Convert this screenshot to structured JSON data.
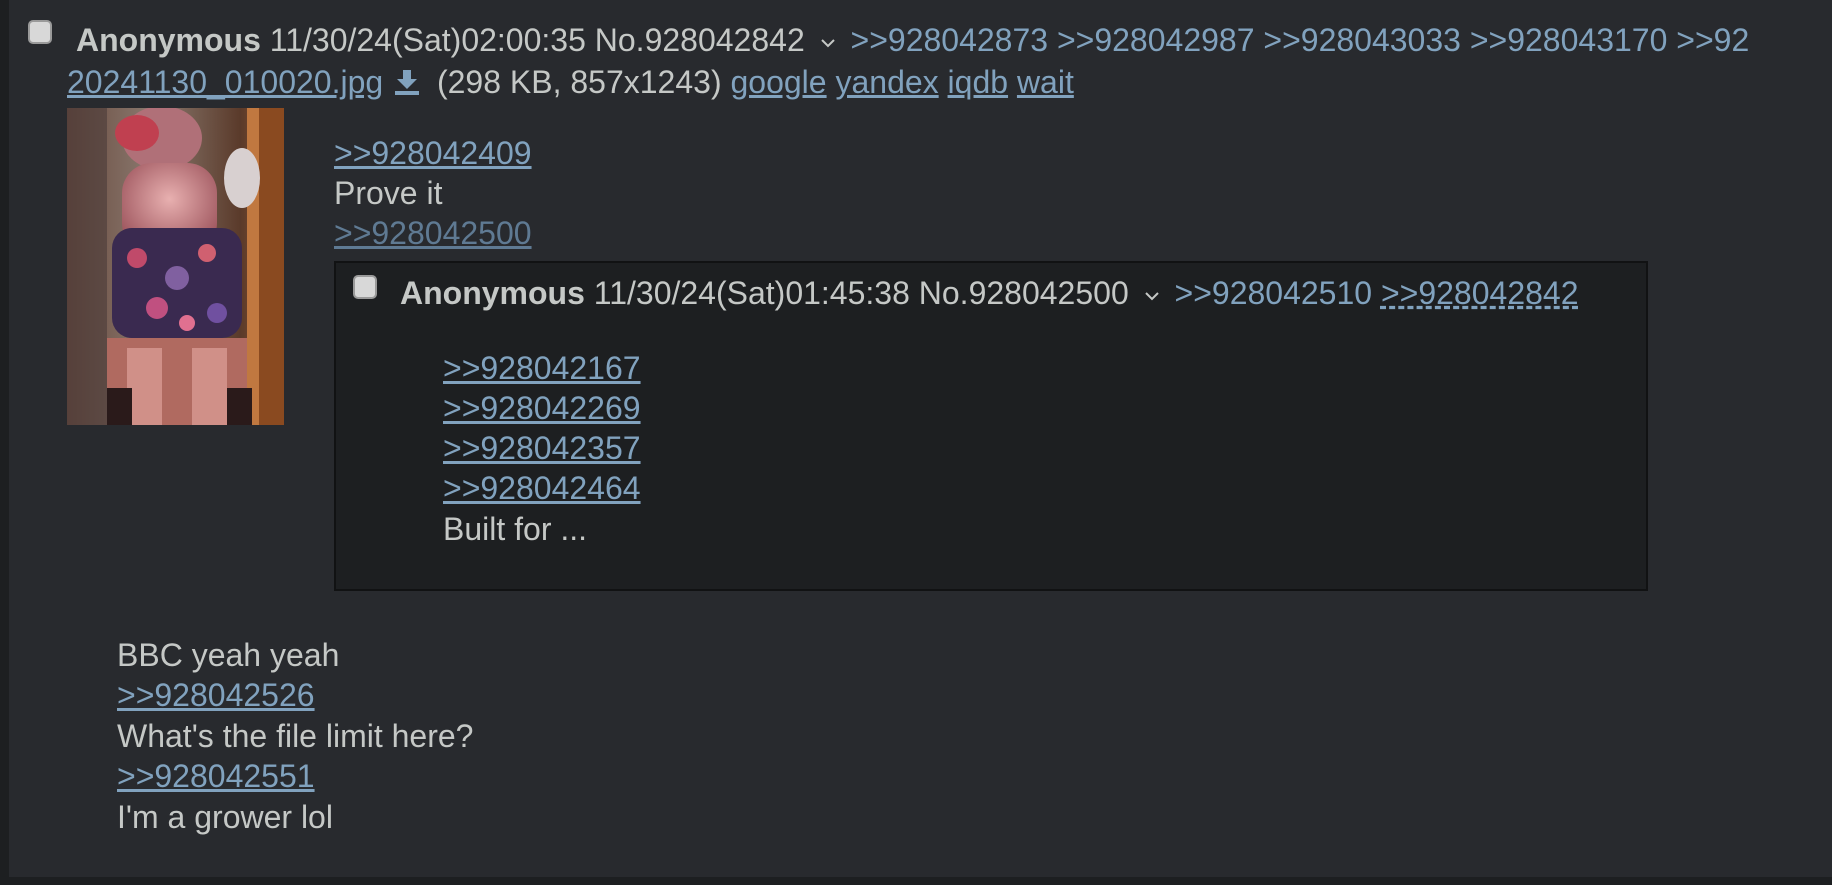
{
  "op_post": {
    "name": "Anonymous",
    "datetime": "11/30/24(Sat)02:00:35",
    "number": "No.928042842",
    "backlinks": [
      ">>928042873",
      ">>928042987",
      ">>928043033",
      ">>928043170",
      ">>92"
    ],
    "file": {
      "name": "20241130_010020.jpg",
      "info": "(298 KB, 857x1243)",
      "search_links": [
        "google",
        "yandex",
        "iqdb",
        "wait"
      ]
    },
    "quote_lines": [
      {
        "type": "link",
        "text": ">>928042409"
      },
      {
        "type": "text",
        "text": "Prove it"
      },
      {
        "type": "link-dim",
        "text": ">>928042500"
      }
    ],
    "body_lines": [
      {
        "type": "text",
        "text": "BBC yeah yeah"
      },
      {
        "type": "link",
        "text": ">>928042526"
      },
      {
        "type": "text",
        "text": "What's the file limit here?"
      },
      {
        "type": "link",
        "text": ">>928042551"
      },
      {
        "type": "text",
        "text": "I'm a grower lol"
      }
    ]
  },
  "inline_post": {
    "name": "Anonymous",
    "datetime": "11/30/24(Sat)01:45:38",
    "number": "No.928042500",
    "backlinks": [
      ">>928042510",
      ">>928042842"
    ],
    "body_lines": [
      {
        "type": "link",
        "text": ">>928042167"
      },
      {
        "type": "link",
        "text": ">>928042269"
      },
      {
        "type": "link",
        "text": ">>928042357"
      },
      {
        "type": "link",
        "text": ">>928042464"
      },
      {
        "type": "text",
        "text": "Built for ..."
      }
    ]
  },
  "colors": {
    "background": "#1d1f21",
    "post_bg": "#282a2e",
    "link": "#81a2be",
    "text": "#c5c8c6"
  },
  "icons": {
    "chevron": "chevron-down-icon",
    "download": "download-icon",
    "checkbox": "checkbox"
  }
}
